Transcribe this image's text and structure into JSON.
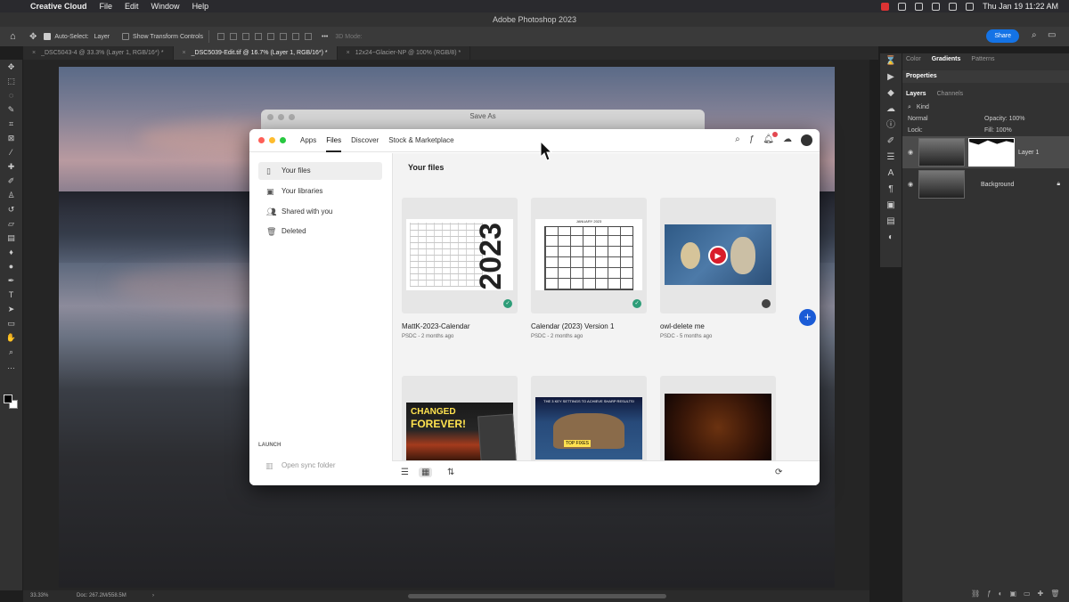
{
  "menubar": {
    "app": "Creative Cloud",
    "items": [
      "File",
      "Edit",
      "Window",
      "Help"
    ],
    "clock": "Thu Jan 19  11:22 AM"
  },
  "ps": {
    "title": "Adobe Photoshop 2023",
    "options": {
      "auto_select": "Auto-Select:",
      "layer_select": "Layer",
      "transform": "Show Transform Controls",
      "mode_3d": "3D Mode:",
      "share": "Share"
    },
    "tabs": [
      "_DSC5043-4 @ 33.3% (Layer 1, RGB/16*) *",
      "_DSC5039-Edit.tif @ 16.7% (Layer 1, RGB/16*) *",
      "12x24~Glacier-NP @ 100% (RGB/8) *"
    ],
    "status": {
      "zoom": "33.33%",
      "doc": "Doc: 267.2M/558.5M",
      "arrow": "›"
    }
  },
  "panels": {
    "tabs": [
      "Color",
      "Gradients",
      "Patterns"
    ],
    "properties": "Properties",
    "layer_tabs": [
      "Layers",
      "Channels"
    ],
    "kind": "Kind",
    "blend": "Normal",
    "opacity": "Opacity: 100%",
    "lock": "Lock:",
    "fill": "Fill: 100%",
    "layers": [
      {
        "name": "Layer 1"
      },
      {
        "name": "Background"
      }
    ]
  },
  "saveas": {
    "title": "Save As"
  },
  "cc": {
    "nav": [
      "Apps",
      "Files",
      "Discover",
      "Stock & Marketplace"
    ],
    "notif_count": "20",
    "sidebar": [
      "Your files",
      "Your libraries",
      "Shared with you",
      "Deleted"
    ],
    "launch": "LAUNCH",
    "sync": "Open sync folder",
    "main_title": "Your files",
    "files": [
      {
        "name": "MattK-2023-Calendar",
        "meta": "PSDC - 2 months ago",
        "thumb_text": "2023"
      },
      {
        "name": "Calendar (2023) Version 1",
        "meta": "PSDC - 2 months ago",
        "thumb_text": "JANUARY 2023"
      },
      {
        "name": "owl-delete me",
        "meta": "PSDC - 5 months ago"
      }
    ],
    "row2": [
      {
        "thumb_text1": "CHANGED",
        "thumb_text2": "FOREVER!"
      },
      {
        "thumb_header": "THE 3 KEY SETTINGS TO ACHIEVE SHARP RESULTS!",
        "thumb_tag": "TOP FIXES"
      },
      {}
    ]
  }
}
